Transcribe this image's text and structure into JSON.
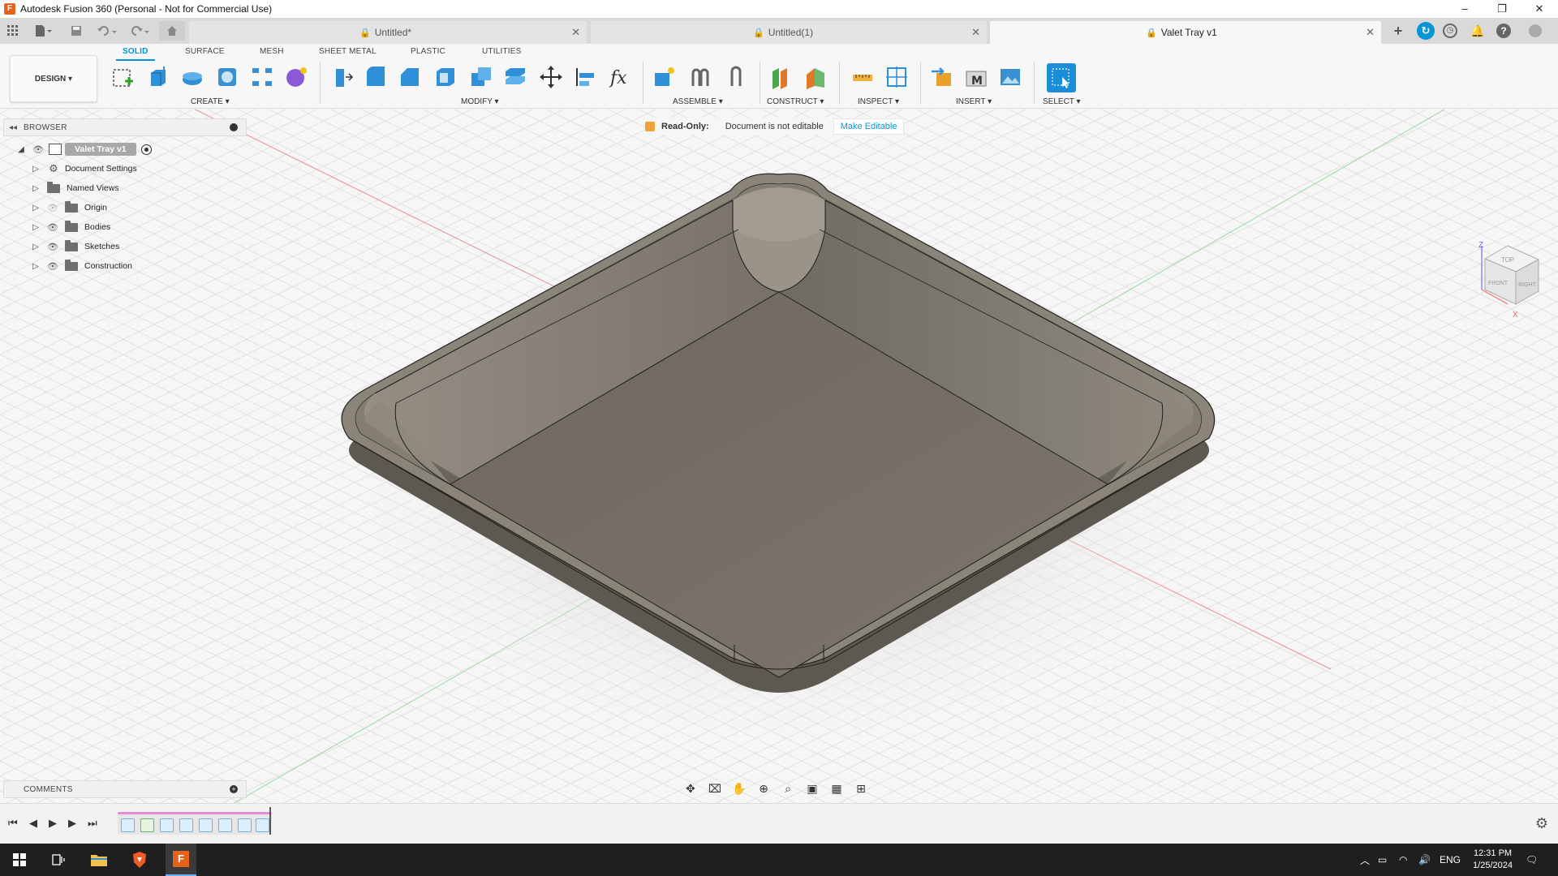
{
  "window": {
    "title": "Autodesk Fusion 360 (Personal - Not for Commercial Use)",
    "logo_letter": "F",
    "buttons": [
      "–",
      "❐",
      "✕"
    ]
  },
  "tabs": [
    {
      "label": "Untitled*",
      "active": false,
      "locked": true
    },
    {
      "label": "Untitled(1)",
      "active": false,
      "locked": true
    },
    {
      "label": "Valet Tray v1",
      "active": true,
      "locked": true
    }
  ],
  "ribbon": {
    "workspace": "DESIGN ▾",
    "tabs": [
      "SOLID",
      "SURFACE",
      "MESH",
      "SHEET METAL",
      "PLASTIC",
      "UTILITIES"
    ],
    "active_tab": "SOLID",
    "groups": {
      "create": "CREATE ▾",
      "modify": "MODIFY ▾",
      "assemble": "ASSEMBLE ▾",
      "construct": "CONSTRUCT ▾",
      "inspect": "INSPECT ▾",
      "insert": "INSERT ▾",
      "select": "SELECT ▾"
    }
  },
  "readonly_banner": {
    "label": "Read-Only:",
    "message": "Document is not editable",
    "action": "Make Editable"
  },
  "browser": {
    "title": "BROWSER",
    "root": "Valet Tray v1",
    "items": [
      {
        "label": "Document Settings",
        "icon": "gear-icon"
      },
      {
        "label": "Named Views",
        "icon": "folder-icon"
      },
      {
        "label": "Origin",
        "icon": "folder-icon"
      },
      {
        "label": "Bodies",
        "icon": "folder-icon"
      },
      {
        "label": "Sketches",
        "icon": "folder-icon"
      },
      {
        "label": "Construction",
        "icon": "folder-icon"
      }
    ]
  },
  "comments": {
    "title": "COMMENTS"
  },
  "viewcube": {
    "top": "TOP",
    "front": "FRONT",
    "right": "RIGHT",
    "z": "Z",
    "x": "X"
  },
  "taskbar": {
    "time": "12:31 PM",
    "date": "1/25/2024",
    "lang": "ENG"
  },
  "colors": {
    "accent": "#0696d7",
    "tray": "#7d766c",
    "timeline_bar": "#e48bd8"
  }
}
